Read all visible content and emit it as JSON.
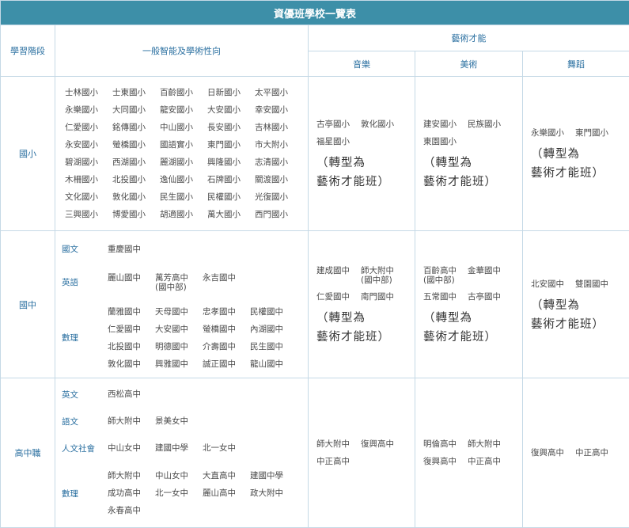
{
  "title": "資優班學校一覽表",
  "headers": {
    "stage": "學習階段",
    "general": "一般智能及學術性向",
    "arts": "藝術才能",
    "music": "音樂",
    "fine_arts": "美術",
    "dance": "舞蹈"
  },
  "elementary": {
    "label": "國小",
    "general_rows": [
      [
        "士林國小",
        "士東國小",
        "百齡國小",
        "日新國小",
        "太平國小"
      ],
      [
        "永樂國小",
        "大同國小",
        "龍安國小",
        "大安國小",
        "幸安國小"
      ],
      [
        "仁愛國小",
        "銘傳國小",
        "中山國小",
        "長安國小",
        "吉林國小"
      ],
      [
        "永安國小",
        "螢橋國小",
        "國語實小",
        "東門國小",
        "市大附小"
      ],
      [
        "碧湖國小",
        "西湖國小",
        "麗湖國小",
        "興隆國小",
        "志清國小"
      ],
      [
        "木柵國小",
        "北投國小",
        "逸仙國小",
        "石牌國小",
        "關渡國小"
      ],
      [
        "文化國小",
        "敦化國小",
        "民生國小",
        "民權國小",
        "光復國小"
      ],
      [
        "三興國小",
        "博愛國小",
        "胡適國小",
        "萬大國小",
        "西門國小"
      ]
    ],
    "music": [
      "古亭國小",
      "敦化國小",
      "福星國小"
    ],
    "fine_arts": [
      "建安國小",
      "民族國小",
      "東園國小"
    ],
    "dance": [
      "永樂國小",
      "東門國小"
    ],
    "note_line1": "（轉型為",
    "note_line2": "藝術才能班）"
  },
  "junior": {
    "label": "國中",
    "subjects": [
      {
        "name": "國文",
        "schools": [
          "重慶國中"
        ]
      },
      {
        "name": "英語",
        "schools": [
          "麗山國中",
          "萬芳高中\n(國中部)",
          "永吉國中"
        ]
      },
      {
        "name": "數理",
        "schools": [
          "蘭雅國中",
          "天母國中",
          "忠孝國中",
          "民權國中",
          "仁愛國中",
          "大安國中",
          "螢橋國中",
          "內湖國中",
          "北投國中",
          "明德國中",
          "介壽國中",
          "民生國中",
          "敦化國中",
          "興雅國中",
          "誠正國中",
          "龍山國中"
        ]
      }
    ],
    "music": [
      "建成國中",
      "師大附中\n(國中部)",
      "仁愛國中",
      "南門國中"
    ],
    "fine_arts": [
      "百齡高中\n(國中部)",
      "金華國中",
      "五常國中",
      "古亭國中"
    ],
    "dance": [
      "北安國中",
      "雙園國中"
    ],
    "note_line1": "（轉型為",
    "note_line2": "藝術才能班）"
  },
  "senior": {
    "label": "高中職",
    "subjects": [
      {
        "name": "英文",
        "schools": [
          "西松高中"
        ]
      },
      {
        "name": "語文",
        "schools": [
          "師大附中",
          "景美女中"
        ]
      },
      {
        "name": "人文社會",
        "schools": [
          "中山女中",
          "建國中學",
          "北一女中"
        ]
      },
      {
        "name": "數理",
        "schools": [
          "師大附中",
          "中山女中",
          "大直高中",
          "建國中學",
          "成功高中",
          "北一女中",
          "麗山高中",
          "政大附中",
          "永春高中"
        ]
      }
    ],
    "music": [
      "師大附中",
      "復興高中",
      "中正高中"
    ],
    "fine_arts": [
      "明倫高中",
      "師大附中",
      "復興高中",
      "中正高中"
    ],
    "dance": [
      "復興高中",
      "中正高中"
    ]
  }
}
